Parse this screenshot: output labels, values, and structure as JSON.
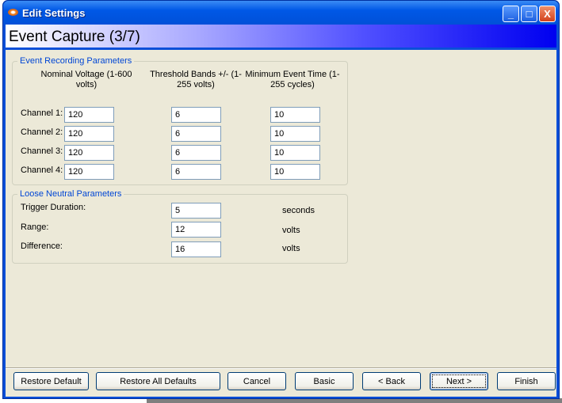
{
  "window": {
    "title": "Edit Settings",
    "minimize": "_",
    "maximize": "□",
    "close": "X"
  },
  "banner": "Event Capture (3/7)",
  "event_group": {
    "legend": "Event Recording Parameters",
    "headers": [
      "Nominal Voltage (1-600 volts)",
      "Threshold Bands +/- (1-255 volts)",
      "Minimum Event Time (1-255 cycles)"
    ],
    "rows": [
      {
        "label": "Channel 1:",
        "values": [
          "120",
          "6",
          "10"
        ]
      },
      {
        "label": "Channel 2:",
        "values": [
          "120",
          "6",
          "10"
        ]
      },
      {
        "label": "Channel 3:",
        "values": [
          "120",
          "6",
          "10"
        ]
      },
      {
        "label": "Channel 4:",
        "values": [
          "120",
          "6",
          "10"
        ]
      }
    ]
  },
  "neutral_group": {
    "legend": "Loose Neutral Parameters",
    "rows": [
      {
        "label": "Trigger Duration:",
        "value": "5",
        "unit": "seconds"
      },
      {
        "label": "Range:",
        "value": "12",
        "unit": "volts"
      },
      {
        "label": "Difference:",
        "value": "16",
        "unit": "volts"
      }
    ]
  },
  "buttons": {
    "restore_default": "Restore Default",
    "restore_all": "Restore All Defaults",
    "cancel": "Cancel",
    "basic": "Basic",
    "back": "< Back",
    "next": "Next >",
    "finish": "Finish"
  }
}
